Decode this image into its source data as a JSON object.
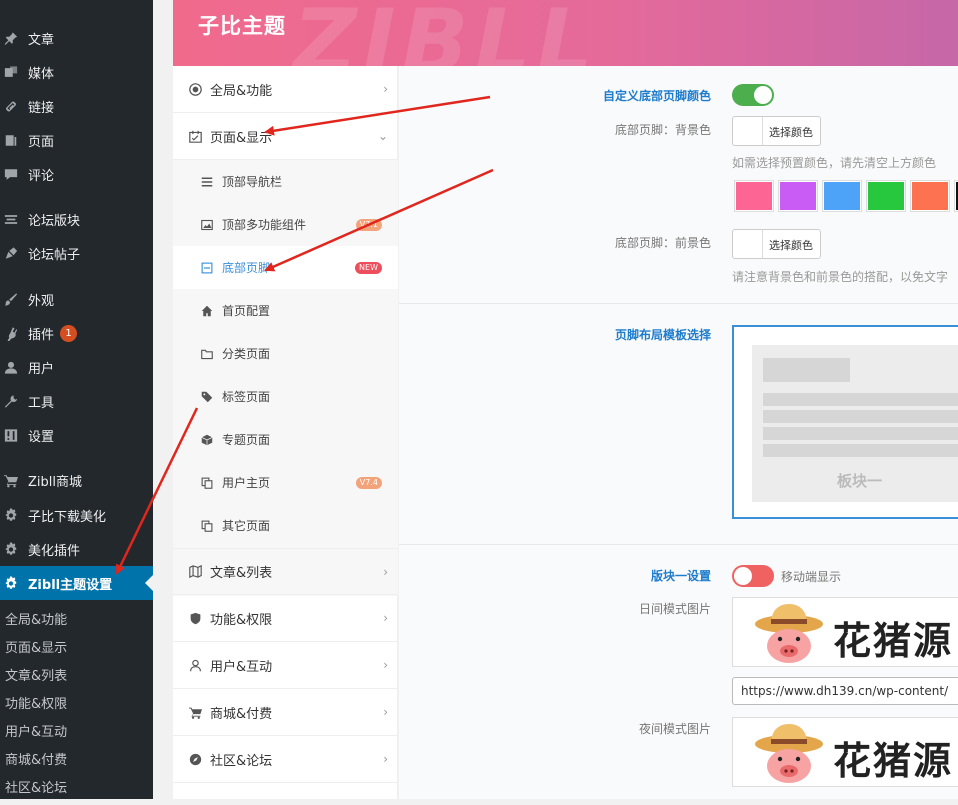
{
  "sidebar": {
    "items": [
      {
        "label": "文章",
        "icon": "pin-icon"
      },
      {
        "label": "媒体",
        "icon": "media-icon"
      },
      {
        "label": "链接",
        "icon": "link-icon"
      },
      {
        "label": "页面",
        "icon": "page-icon"
      },
      {
        "label": "评论",
        "icon": "comment-icon"
      },
      {
        "label": "论坛版块",
        "icon": "forum-icon"
      },
      {
        "label": "论坛帖子",
        "icon": "forum-post-icon"
      },
      {
        "label": "外观",
        "icon": "appearance-icon"
      },
      {
        "label": "插件",
        "icon": "plugin-icon",
        "badge": "1"
      },
      {
        "label": "用户",
        "icon": "user-icon"
      },
      {
        "label": "工具",
        "icon": "tools-icon"
      },
      {
        "label": "设置",
        "icon": "settings-icon"
      },
      {
        "label": "Zibll商城",
        "icon": "cart-icon"
      },
      {
        "label": "子比下载美化",
        "icon": "gear-icon"
      },
      {
        "label": "美化插件",
        "icon": "gear-icon"
      },
      {
        "label": "Zibll主题设置",
        "icon": "gear-icon",
        "active": true
      }
    ],
    "subitems": [
      "全局&功能",
      "页面&显示",
      "文章&列表",
      "功能&权限",
      "用户&互动",
      "商城&付费",
      "社区&论坛"
    ]
  },
  "header": {
    "title": "子比主题",
    "watermark": "ZIBLL"
  },
  "nav": {
    "top": [
      {
        "label": "全局&功能",
        "icon": "target-icon",
        "chevron": "›"
      },
      {
        "label": "页面&显示",
        "icon": "calendar-check-icon",
        "chevron": "⌄"
      }
    ],
    "sub": [
      {
        "label": "顶部导航栏",
        "icon": "menu-icon"
      },
      {
        "label": "顶部多功能组件",
        "icon": "image-icon",
        "tag": "V7.1"
      },
      {
        "label": "底部页脚",
        "icon": "minus-square-icon",
        "tag": "NEW",
        "selected": true
      },
      {
        "label": "首页配置",
        "icon": "home-icon"
      },
      {
        "label": "分类页面",
        "icon": "folder-icon"
      },
      {
        "label": "标签页面",
        "icon": "tags-icon"
      },
      {
        "label": "专题页面",
        "icon": "cube-icon"
      },
      {
        "label": "用户主页",
        "icon": "copy-icon",
        "tag": "V7.4"
      },
      {
        "label": "其它页面",
        "icon": "copy-icon"
      }
    ],
    "bottom": [
      {
        "label": "文章&列表",
        "icon": "map-icon",
        "chevron": "›"
      },
      {
        "label": "功能&权限",
        "icon": "shield-icon",
        "chevron": "›"
      },
      {
        "label": "用户&互动",
        "icon": "user-icon",
        "chevron": "›"
      },
      {
        "label": "商城&付费",
        "icon": "cart-icon",
        "chevron": "›"
      },
      {
        "label": "社区&论坛",
        "icon": "compass-icon",
        "chevron": "›"
      }
    ]
  },
  "content": {
    "footer_color": {
      "label": "自定义底部页脚颜色",
      "toggle_on": true,
      "bg_label": "底部页脚：背景色",
      "bg_button": "选择颜色",
      "bg_hint": "如需选择预置颜色，请先清空上方颜色",
      "presets": [
        "#fd6594",
        "#c95cf5",
        "#4ca3f8",
        "#27c73e",
        "#fd7251",
        "#111111"
      ],
      "fg_label": "底部页脚：前景色",
      "fg_button": "选择颜色",
      "fg_hint": "请注意背景色和前景色的搭配，以免文字"
    },
    "template": {
      "label": "页脚布局模板选择",
      "block_text": "板块一"
    },
    "block1": {
      "label": "版块一设置",
      "toggle_on": false,
      "toggle_text": "移动端显示",
      "day_label": "日间模式图片",
      "logo_text": "花猪源",
      "url": "https://www.dh139.cn/wp-content/",
      "night_label": "夜间模式图片",
      "night_logo_text": "花猪源"
    }
  },
  "colors": {
    "accent": "#1e7ccc",
    "wp_sidebar": "#23282d",
    "wp_active": "#0073aa",
    "toggle_on": "#4cae4c",
    "toggle_off": "#f06262",
    "arrow": "#e0261d"
  }
}
